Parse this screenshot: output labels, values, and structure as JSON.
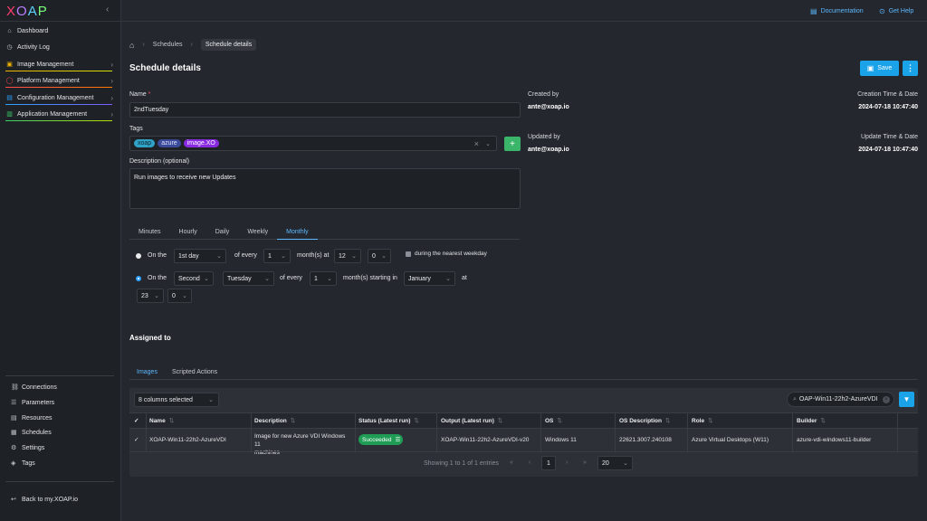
{
  "app": {
    "logo": "XOAP"
  },
  "sidebar": {
    "items": [
      {
        "label": "Dashboard",
        "icon": "home-icon"
      },
      {
        "label": "Activity Log",
        "icon": "clock-icon"
      },
      {
        "label": "Image Management",
        "icon": "image-icon",
        "accent": "#f0b400"
      },
      {
        "label": "Platform Management",
        "icon": "platform-icon",
        "accent": "#ff4b4b"
      },
      {
        "label": "Configuration Management",
        "icon": "config-icon",
        "accent": "#2fa3ff"
      },
      {
        "label": "Application Management",
        "icon": "apps-icon",
        "accent": "#3fcf6a"
      }
    ],
    "bottom_items": [
      {
        "label": "Connections",
        "icon": "link-icon"
      },
      {
        "label": "Parameters",
        "icon": "list-icon"
      },
      {
        "label": "Resources",
        "icon": "stack-icon"
      },
      {
        "label": "Schedules",
        "icon": "calendar-icon"
      },
      {
        "label": "Settings",
        "icon": "gear-icon"
      },
      {
        "label": "Tags",
        "icon": "tag-icon"
      }
    ],
    "back_link": "Back to my.XOAP.io"
  },
  "topbar": {
    "documentation": "Documentation",
    "get_help": "Get Help"
  },
  "breadcrumb": {
    "schedules": "Schedules",
    "current": "Schedule details"
  },
  "page": {
    "title": "Schedule details",
    "save": "Save"
  },
  "form": {
    "name_label": "Name",
    "name_required": "*",
    "name_value": "2ndTuesday",
    "tags_label": "Tags",
    "tags": [
      {
        "label": "xoap",
        "color": "#2fa3c8"
      },
      {
        "label": "azure",
        "color": "#3b4a9a"
      },
      {
        "label": "image.XO",
        "color": "#8a2be2"
      }
    ],
    "description_label": "Description (optional)",
    "description_value": "Run images to receive new Updates"
  },
  "meta": {
    "created_by_label": "Created by",
    "created_by": "ante@xoap.io",
    "creation_time_label": "Creation Time & Date",
    "creation_time": "2024-07-18 10:47:40",
    "updated_by_label": "Updated by",
    "updated_by": "ante@xoap.io",
    "update_time_label": "Update Time & Date",
    "update_time": "2024-07-18 10:47:40"
  },
  "schedule": {
    "tabs": [
      "Minutes",
      "Hourly",
      "Daily",
      "Weekly",
      "Monthly"
    ],
    "active_tab": "Monthly",
    "row1": {
      "on_the": "On the",
      "day": "1st day",
      "of_every": "of every",
      "months": "1",
      "months_at": "month(s) at",
      "hour": "12",
      "minute": "0",
      "nearest": "during the nearest weekday"
    },
    "row2": {
      "on_the": "On the",
      "ordinal": "Second",
      "weekday": "Tuesday",
      "of_every": "of every",
      "months": "1",
      "starting": "month(s) starting in",
      "month": "January",
      "at": "at",
      "hour": "23",
      "minute": "0"
    }
  },
  "assigned": {
    "title": "Assigned to",
    "tabs": [
      "Images",
      "Scripted Actions"
    ],
    "columns_selected": "8 columns selected",
    "search_value": "OAP-Win11-22h2-AzureVDI",
    "headers": [
      "Name",
      "Description",
      "Status (Latest run)",
      "Output (Latest run)",
      "OS",
      "OS Description",
      "Role",
      "Builder"
    ],
    "row": {
      "name": "XOAP-Win11-22h2-AzureVDI",
      "description_line1": "Image for new Azure VDI Windows 11",
      "description_line2": "machines",
      "status": "Succeeded",
      "output": "XOAP-Win11-22h2-AzureVDI-v20",
      "os": "Windows 11",
      "os_description": "22621.3007.240108",
      "role": "Azure Virtual Desktops (W11)",
      "builder": "azure-vdi-windows11-builder"
    },
    "pagination": {
      "summary": "Showing 1 to 1 of 1 entries",
      "page": "1",
      "page_size": "20"
    }
  }
}
